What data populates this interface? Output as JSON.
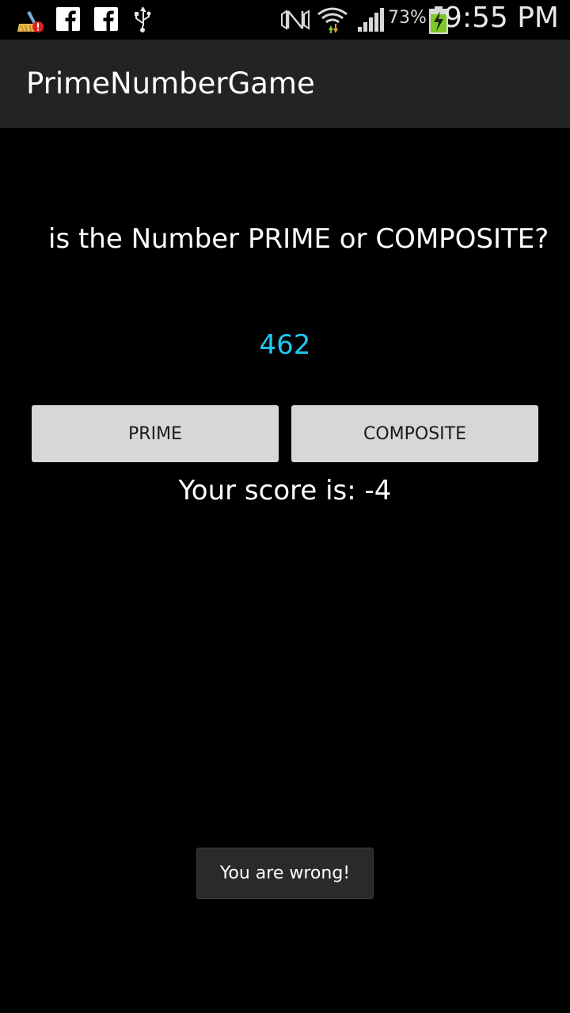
{
  "status_bar": {
    "icons": [
      "cleaner-alert-icon",
      "facebook-icon",
      "facebook-icon",
      "usb-icon",
      "no-sim-icon",
      "wifi-icon",
      "signal-icon",
      "battery-charging-icon"
    ],
    "battery_percent": "73%",
    "time": "9:55 PM",
    "fb_letter": "f"
  },
  "action_bar": {
    "title": "PrimeNumberGame"
  },
  "game": {
    "question": "is the Number PRIME or COMPOSITE?",
    "number": "462",
    "prime_button": "PRIME",
    "composite_button": "COMPOSITE",
    "score_text": "Your score is: -4"
  },
  "toast": {
    "message": "You are wrong!"
  },
  "colors": {
    "background": "#000000",
    "action_bar": "#232323",
    "number_accent": "#1ec8f0",
    "button_bg": "#d6d7d7",
    "battery_green": "#7ec82a"
  }
}
